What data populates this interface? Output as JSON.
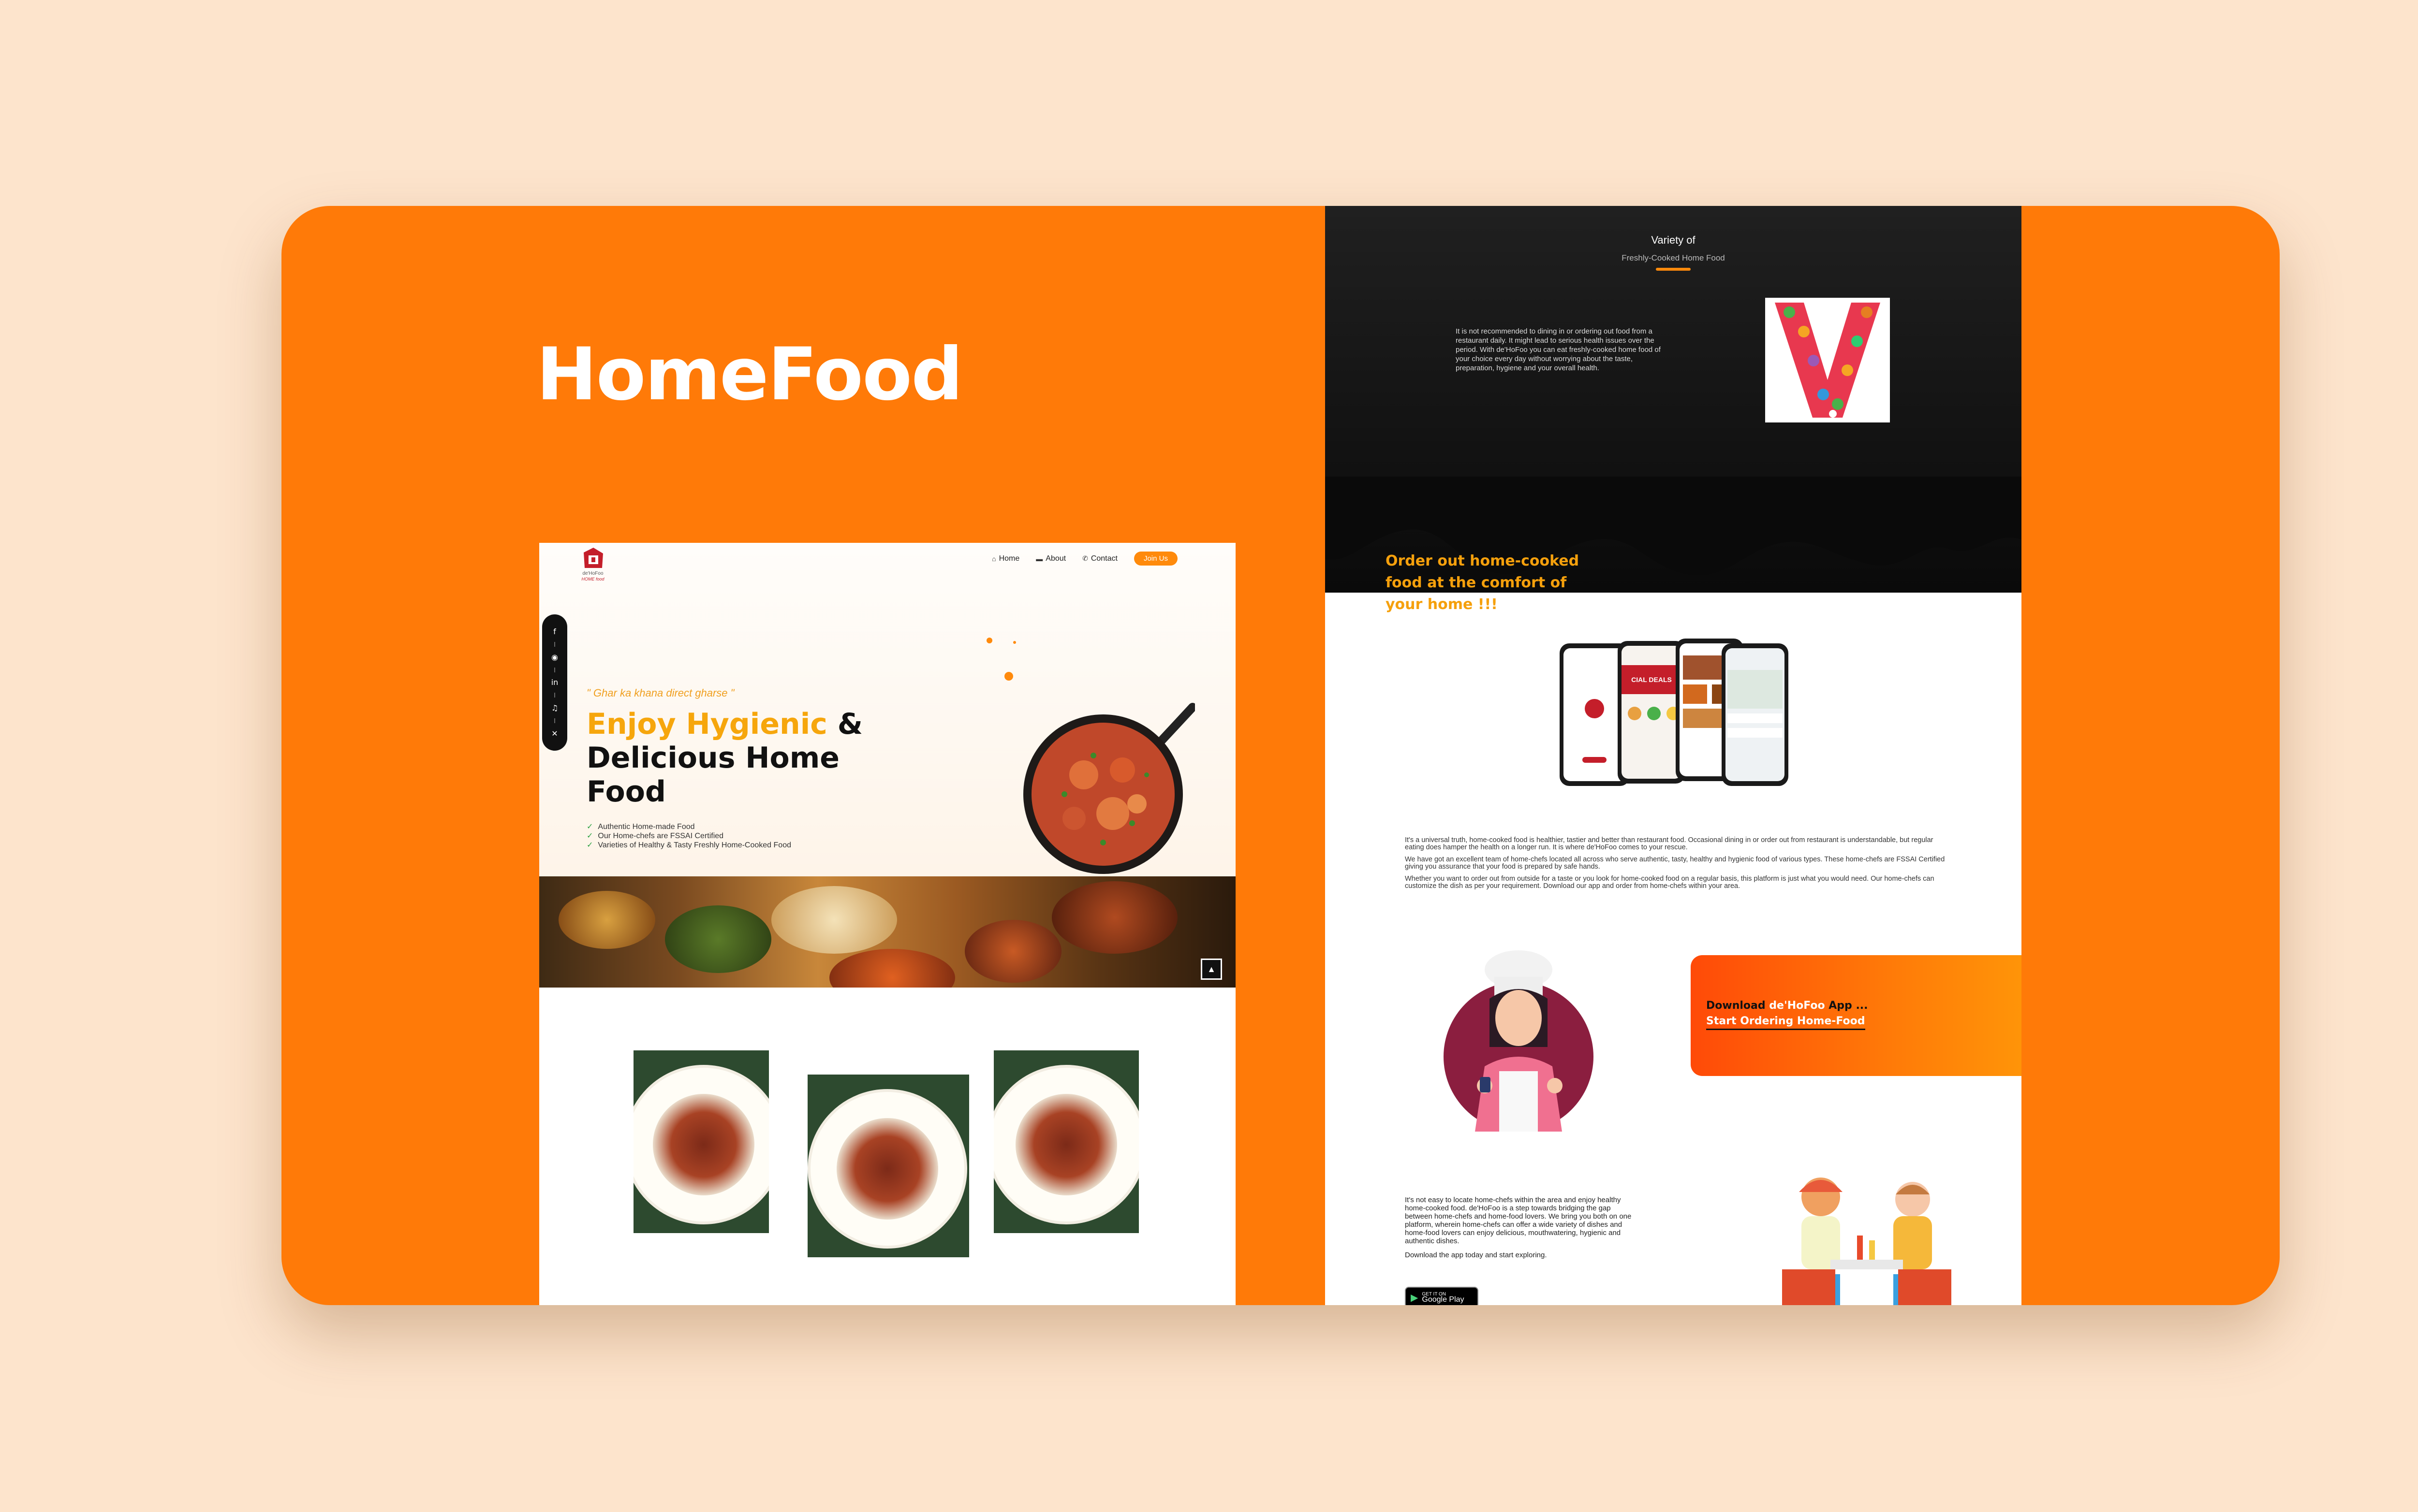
{
  "project_title": "HomeFood",
  "colors": {
    "background": "#fde4cc",
    "card": "#ff7a08",
    "accent": "#ff8a0c",
    "headline_accent": "#f6a60c"
  },
  "left_site": {
    "logo": {
      "brand": "de'HoFoo",
      "sub": "HOME food"
    },
    "nav": {
      "home": "Home",
      "about": "About",
      "contact": "Contact",
      "join": "Join Us"
    },
    "social_icons": [
      "facebook-icon",
      "instagram-icon",
      "linkedin-icon",
      "tiktok-icon",
      "x-icon"
    ],
    "tagline": "\" Ghar ka khana direct gharse \"",
    "headline": {
      "accent": "Enjoy Hygienic",
      "amp": "&",
      "rest": "Delicious Home Food"
    },
    "features": [
      "Authentic Home-made Food",
      "Our Home-chefs are FSSAI Certified",
      "Varieties of Healthy & Tasty Freshly Home-Cooked Food"
    ]
  },
  "right_site": {
    "variety_title": "Variety of",
    "variety_subtitle": "Freshly-Cooked Home Food",
    "variety_text": "It is not recommended to dining in or ordering out food from a restaurant daily. It might lead to serious health issues over the period. With de'HoFoo you can eat freshly-cooked home food of your choice every day without worrying about the taste, preparation, hygiene and your overall health.",
    "order_heading": "Order out home-cooked food at the comfort of your home !!!",
    "phone_screen_banner": "CIAL DEALS",
    "paragraphs": [
      "It's a universal truth, home-cooked food is healthier, tastier and better than restaurant food. Occasional dining in or order out from restaurant is understandable, but regular eating does hamper the health on a longer run. It is where de'HoFoo comes to your rescue.",
      "We have got an excellent team of home-chefs located all across who serve authentic, tasty, healthy and hygienic food of various types. These home-chefs are FSSAI Certified giving you assurance that your food is prepared by safe hands.",
      "Whether you want to order out from outside for a taste or you look for home-cooked food on a regular basis, this platform is just what you would need. Our home-chefs can customize the dish as per your requirement. Download our app and order from home-chefs within your area."
    ],
    "download": {
      "prefix": "Download",
      "brand": "de'HoFoo",
      "suffix": "App ...",
      "line2": "Start Ordering Home-Food"
    },
    "locate_paragraph": "It's not easy to locate home-chefs within the area and enjoy healthy home-cooked food. de'HoFoo is a step towards bridging the gap between home-chefs and home-food lovers. We bring you both on one platform, wherein home-chefs can offer a wide variety of dishes and home-food lovers can enjoy delicious, mouthwatering, hygienic and authentic dishes.",
    "download_note": "Download the app today and start exploring.",
    "play_badge": {
      "top": "GET IT ON",
      "store": "Google Play"
    }
  }
}
